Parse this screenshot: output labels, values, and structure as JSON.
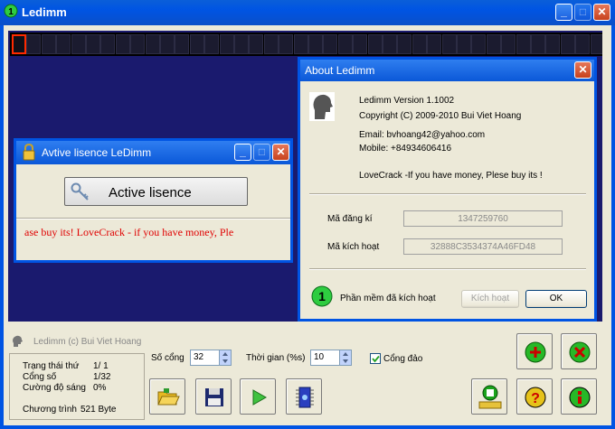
{
  "main_window": {
    "title": "Ledimm",
    "minimize_icon": "minimize-icon",
    "maximize_icon": "maximize-icon",
    "close_icon": "close-icon"
  },
  "display": {
    "led_count": 40
  },
  "about": {
    "title": "About Ledimm",
    "version": "Ledimm Version 1.1002",
    "copyright": "Copyright (C) 2009-2010 Bui Viet Hoang",
    "email": "Email: bvhoang42@yahoo.com",
    "mobile": "Mobile: +84934606416",
    "lovecrack": "LoveCrack -If you have money, Plese buy its !",
    "reg_label": "Mã đăng kí",
    "reg_value": "1347259760",
    "act_label": "Mã kích hoạt",
    "act_value": "32888C3534374A46FD48",
    "status": "Phần mềm đã kích hoạt",
    "activate_button": "Kích hoạt",
    "ok_button": "OK"
  },
  "license": {
    "title": "Avtive lisence LeDimm",
    "button": "Active lisence",
    "marquee": "ase buy its!   LoveCrack - if you have money, Ple"
  },
  "footer": {
    "credit": "Ledimm (c) Bui Viet Hoang",
    "status_rows": [
      {
        "label": "Trạng thái thứ",
        "value": "1/ 1"
      },
      {
        "label": "Cổng số",
        "value": "1/32"
      },
      {
        "label": "Cường độ sáng",
        "value": "0%"
      }
    ],
    "program_label": "Chương trình",
    "program_value": "521 Byte",
    "port_label": "Số cổng",
    "port_value": "32",
    "time_label": "Thời gian (%s)",
    "time_value": "10",
    "invert_label": "Cổng đảo",
    "invert_checked": true
  },
  "colors": {
    "titlebar": "#0054e3",
    "display_bg": "#1a1a6e",
    "led_selected": "#ff2a00",
    "marquee_text": "#e00000"
  }
}
